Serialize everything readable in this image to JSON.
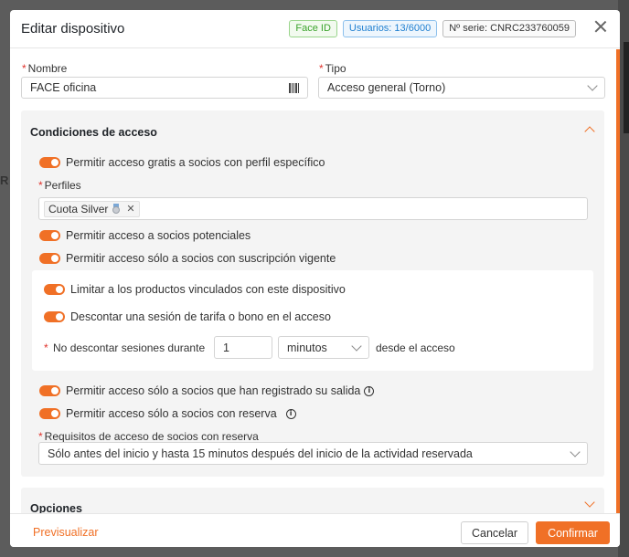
{
  "backdrop": {
    "left_letter": "R"
  },
  "modal": {
    "title": "Editar dispositivo",
    "badges": {
      "face": "Face ID",
      "users": "Usuarios: 13/6000",
      "serie": "Nº serie: CNRC233760059"
    }
  },
  "form": {
    "nombre": {
      "label": "Nombre",
      "value": "FACE oficina"
    },
    "tipo": {
      "label": "Tipo",
      "value": "Acceso general (Torno)"
    }
  },
  "acceso": {
    "title": "Condiciones de acceso",
    "perfil_toggle": "Permitir acceso gratis a socios con perfil específico",
    "perfiles_label": "Perfiles",
    "perfil_tag": "Cuota Silver",
    "potenciales": "Permitir acceso a socios potenciales",
    "suscripcion": "Permitir acceso sólo a socios con suscripción vigente",
    "limitar": "Limitar a los productos vinculados con este dispositivo",
    "descontar": "Descontar una sesión de tarifa o bono en el acceso",
    "no_descontar_label": "No descontar sesiones durante",
    "no_descontar_value": "1",
    "unidad": "minutos",
    "desde": "desde el acceso",
    "salida": "Permitir acceso sólo a socios que han registrado su salida",
    "reserva": "Permitir acceso sólo a socios con reserva",
    "requisitos_label": "Requisitos de acceso de socios con reserva",
    "requisitos_value": "Sólo antes del inicio y hasta 15 minutos después del inicio de la actividad reservada"
  },
  "opciones": {
    "title": "Opciones"
  },
  "footer": {
    "preview": "Previsualizar",
    "cancel": "Cancelar",
    "confirm": "Confirmar"
  },
  "colors": {
    "accent": "#f07026",
    "required": "#e0332c",
    "badge_green": "#3ba32c",
    "badge_blue": "#1f7fd0"
  },
  "icons": {
    "close": "close-icon",
    "barcode": "barcode-icon",
    "info": "info-icon",
    "medal": "medal-icon"
  }
}
